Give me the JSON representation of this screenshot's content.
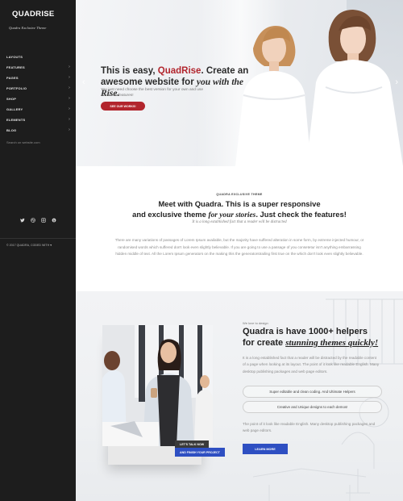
{
  "sidebar": {
    "logo": "QUADRISE",
    "tagline": "Quadra Exclusive Theme",
    "nav": [
      {
        "label": "LAYOUTS",
        "has_children": false
      },
      {
        "label": "FEATURES",
        "has_children": true
      },
      {
        "label": "PAGES",
        "has_children": true
      },
      {
        "label": "PORTFOLIO",
        "has_children": true
      },
      {
        "label": "SHOP",
        "has_children": true
      },
      {
        "label": "GALLERY",
        "has_children": true
      },
      {
        "label": "ELEMENTS",
        "has_children": true
      },
      {
        "label": "BLOG",
        "has_children": true
      }
    ],
    "chevron_glyph": "›",
    "search_placeholder": "Search on website.com",
    "socials": [
      "twitter-icon",
      "dribbble-icon",
      "instagram-icon",
      "skype-icon"
    ],
    "copyright": "© 2017 QUADRA, CODED WITH ♥"
  },
  "hero": {
    "title_part1": "This is easy, ",
    "title_brand": "QuadRise",
    "title_part2": ". Create an awesome website for ",
    "title_serif": "you with the Rise.",
    "text": "You just need choose the best version for your own and use awesome features!",
    "button": "SEE OUR WORKS!",
    "prev_glyph": "‹",
    "next_glyph": "›"
  },
  "intro": {
    "eyebrow": "QUADRA EXCLUSIVE THEME",
    "heading_line1": "Meet with Quadra. This is a super responsive",
    "heading_line2_a": "and exclusive theme ",
    "heading_line2_serif": "for your stories",
    "heading_line2_b": ". Just check the features!",
    "subheading": "It is a long established fact that a reader will be distracted",
    "body": "There are many variations of passages of Lorem Ipsum available, but the majority have suffered alteration in some form, by extreme injected humour, or randomised words which suffered don't look even slightly believable. If you are going to use a passage of you consetetur isn't anything embarrassing hidden middle of text. All the Lorem Ipsum generators on the making this the generatorstrailing first true on the which don't look even slightly believable."
  },
  "features": {
    "eyebrow": "We love to design",
    "heading_line1": "Quadra is have 1000+ helpers",
    "heading_line2_a": "for create ",
    "heading_line2_serif": "stunning themes quickly!",
    "body": "It is a long established fact that a reader will be distracted by the readable content of a page when looking at its layout. The point of it look like readable English. Many desktop publishing packages and web page editors.",
    "pill1": "Super editable and clean coding. And Ultimate Helpers",
    "pill2": "Creative and Unique designs to each demos!",
    "body2": "The point of it look like readable English. Many desktop publishing packages and web page editors.",
    "button": "LEARN MORE",
    "tag1": "LET'S TALK NOW",
    "tag2": "AND FINISH YOUR PROJECT"
  },
  "colors": {
    "sidebar_bg": "#1d1d1d",
    "brand_red": "#b2252d",
    "accent_blue": "#2e4fc2"
  }
}
